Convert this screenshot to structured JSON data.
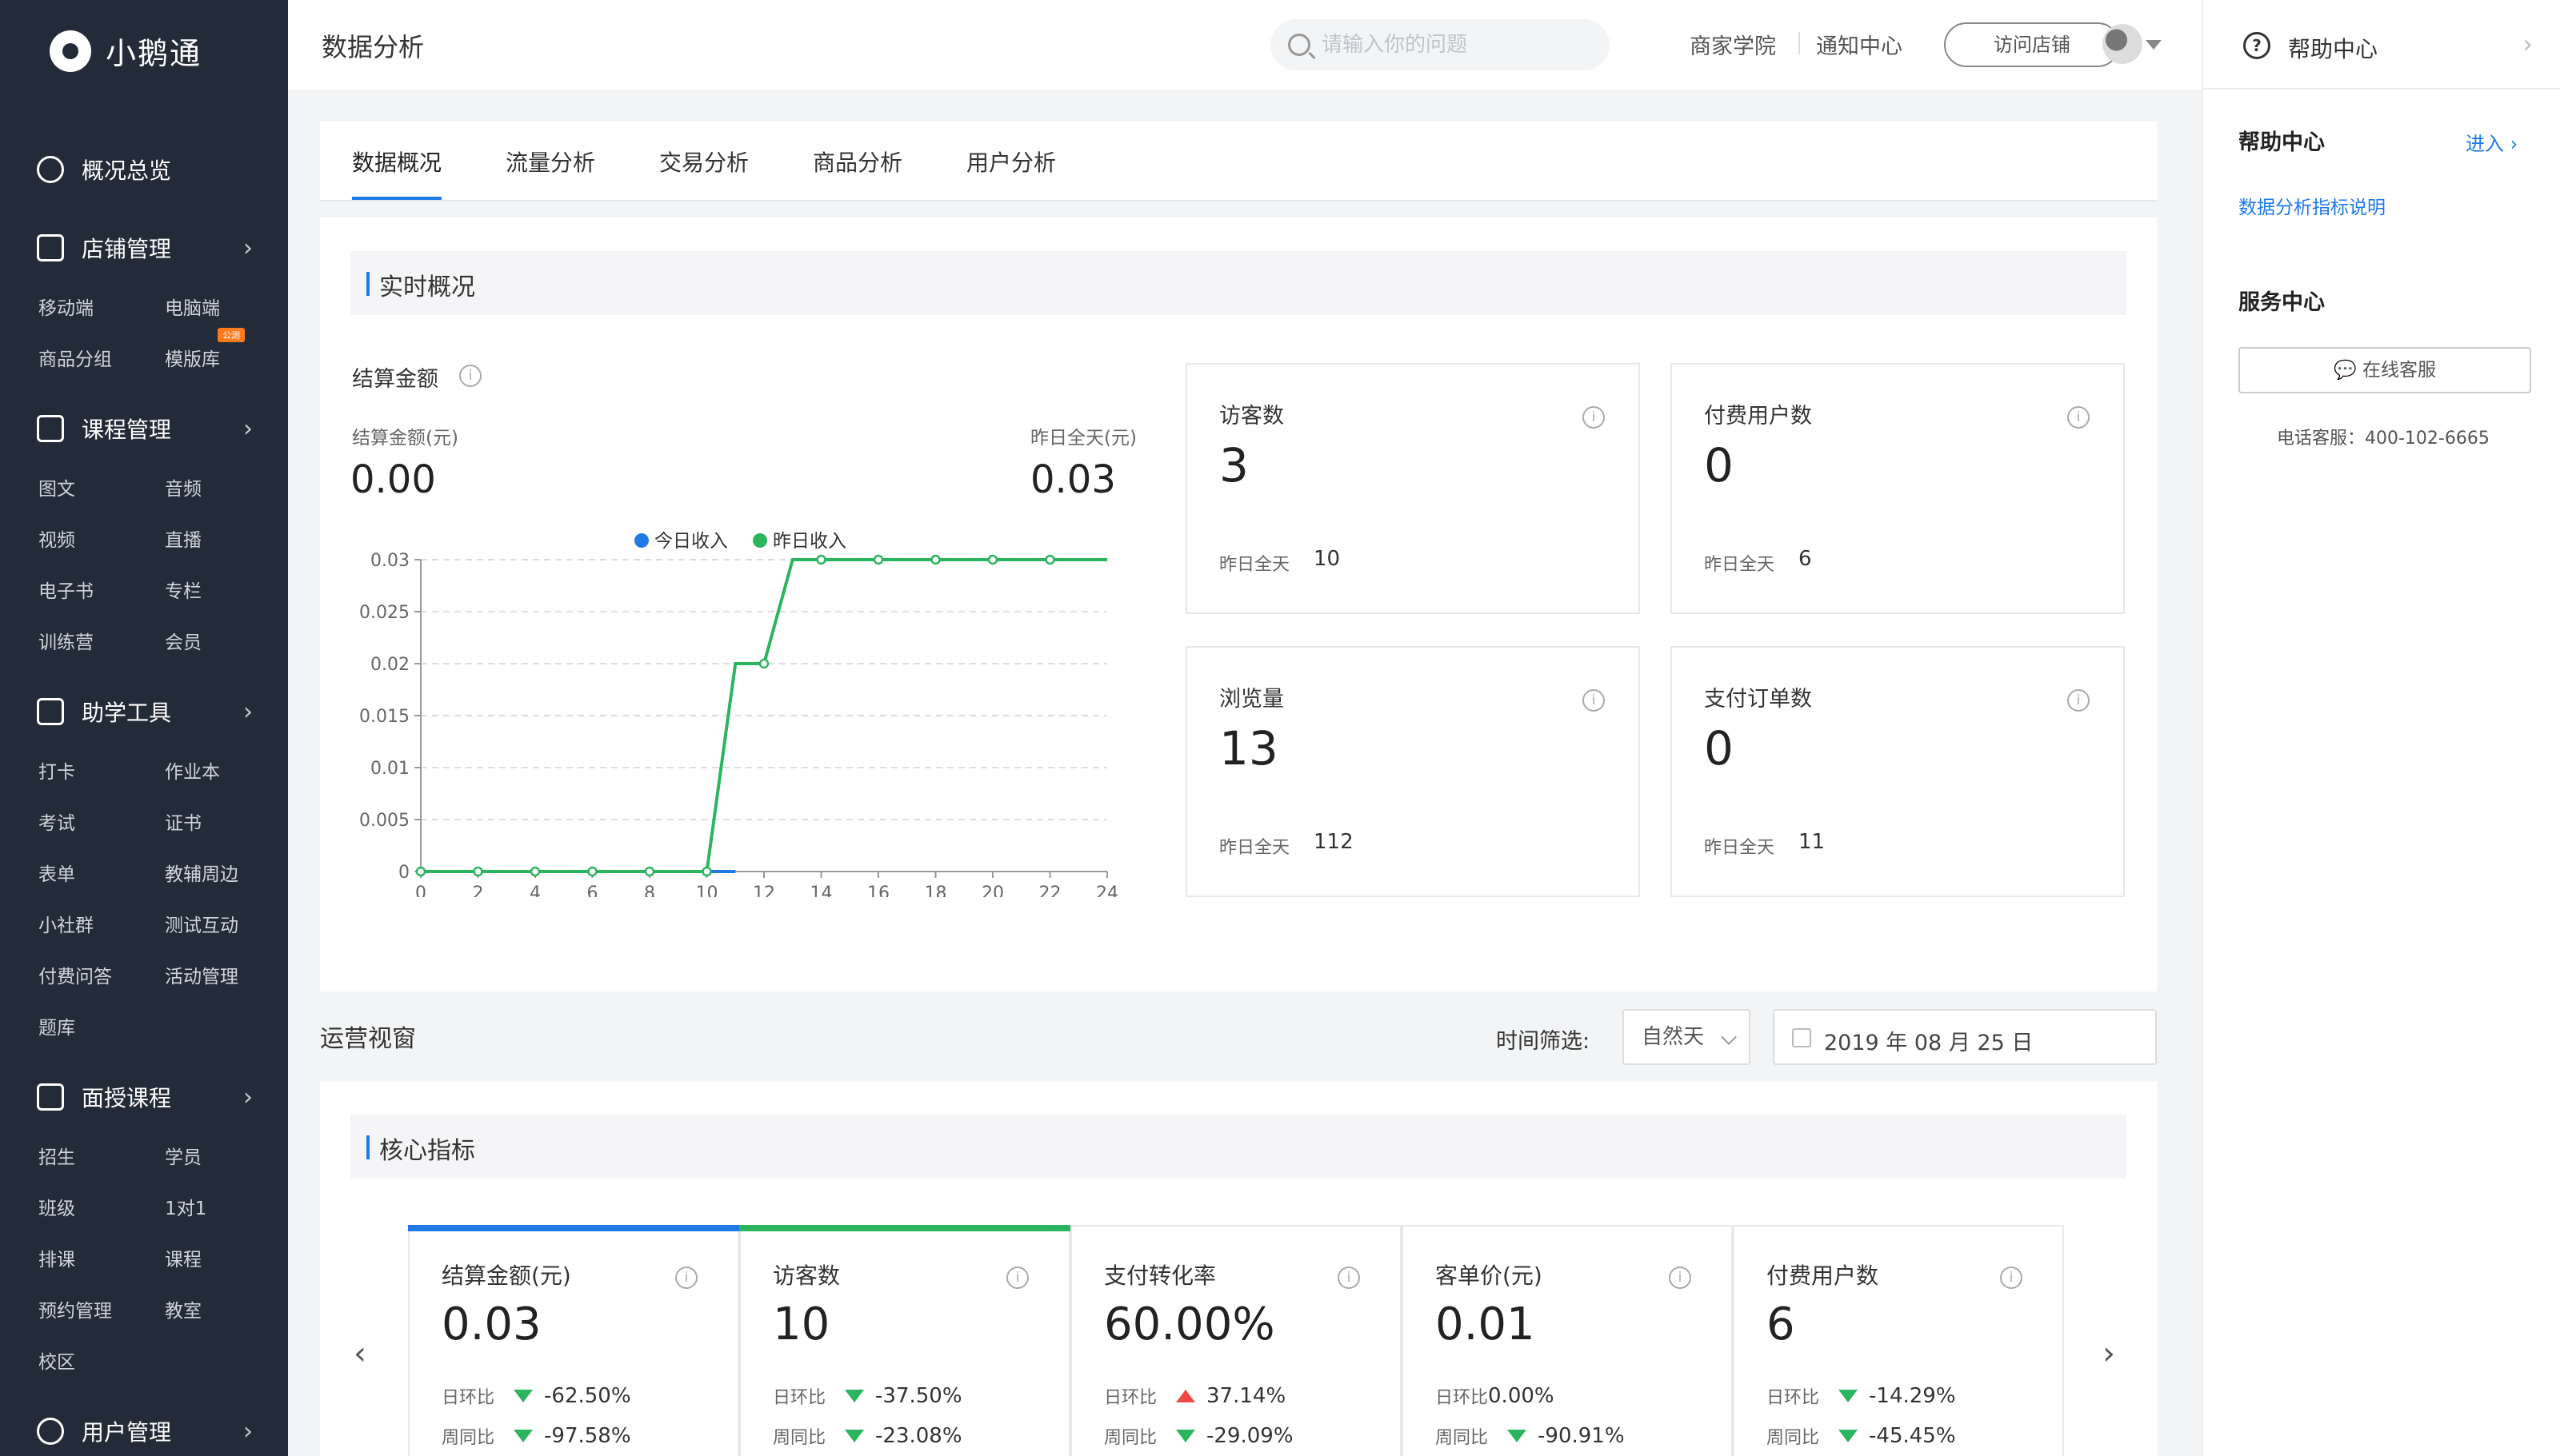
{
  "app": {
    "logo_text": "小鹅通",
    "page_title": "数据分析"
  },
  "sidebar": {
    "groups": [
      {
        "label": "概况总览",
        "icon": "pie-chart-icon",
        "items": []
      },
      {
        "label": "店铺管理",
        "icon": "store-icon",
        "items": [
          "移动端",
          "电脑端",
          "商品分组",
          "模版库"
        ]
      },
      {
        "label": "课程管理",
        "icon": "document-icon",
        "items": [
          "图文",
          "音频",
          "视频",
          "直播",
          "电子书",
          "专栏",
          "训练营",
          "会员"
        ]
      },
      {
        "label": "助学工具",
        "icon": "toolbox-icon",
        "items": [
          "打卡",
          "作业本",
          "考试",
          "证书",
          "表单",
          "教辅周边",
          "小社群",
          "测试互动",
          "付费问答",
          "活动管理",
          "题库"
        ]
      },
      {
        "label": "面授课程",
        "icon": "teacher-icon",
        "items": [
          "招生",
          "学员",
          "班级",
          "1对1",
          "排课",
          "课程",
          "预约管理",
          "教室",
          "校区"
        ]
      },
      {
        "label": "用户管理",
        "icon": "user-icon",
        "items": []
      }
    ],
    "badge": "公测"
  },
  "topbar": {
    "search_placeholder": "请输入你的问题",
    "links": [
      "商家学院",
      "通知中心"
    ],
    "visit_button": "访问店铺"
  },
  "right_panel": {
    "header": "帮助中心",
    "help_title": "帮助中心",
    "enter_link": "进入",
    "doc_link": "数据分析指标说明",
    "service_title": "服务中心",
    "service_button": "在线客服",
    "phone": "电话客服：400-102-6665"
  },
  "tabs": [
    {
      "label": "数据概况",
      "active": true
    },
    {
      "label": "流量分析",
      "active": false
    },
    {
      "label": "交易分析",
      "active": false
    },
    {
      "label": "商品分析",
      "active": false
    },
    {
      "label": "用户分析",
      "active": false
    }
  ],
  "realtime": {
    "section_title": "实时概况",
    "settlement_title": "结算金额",
    "today_label": "结算金额(元)",
    "today_value": "0.00",
    "yesterday_label": "昨日全天(元)",
    "yesterday_value": "0.03",
    "metrics": [
      {
        "label": "访客数",
        "value": "3",
        "yesterday_label": "昨日全天",
        "yesterday_value": "10"
      },
      {
        "label": "付费用户数",
        "value": "0",
        "yesterday_label": "昨日全天",
        "yesterday_value": "6"
      },
      {
        "label": "浏览量",
        "value": "13",
        "yesterday_label": "昨日全天",
        "yesterday_value": "112"
      },
      {
        "label": "支付订单数",
        "value": "0",
        "yesterday_label": "昨日全天",
        "yesterday_value": "11"
      }
    ]
  },
  "chart_data": {
    "type": "line",
    "xlim": [
      0,
      24
    ],
    "ylim": [
      0,
      0.03
    ],
    "xticks": [
      "0",
      "2",
      "4",
      "6",
      "8",
      "10",
      "12",
      "14",
      "16",
      "18",
      "20",
      "22",
      "24"
    ],
    "yticks": [
      "0",
      "0.005",
      "0.01",
      "0.015",
      "0.02",
      "0.025",
      "0.03"
    ],
    "grid": true,
    "legend_position": "top-center",
    "series": [
      {
        "name": "今日收入",
        "color": "#1f7ae8",
        "x": [
          0,
          1,
          2,
          3,
          4,
          5,
          6,
          7,
          8,
          9,
          10,
          11
        ],
        "y": [
          0,
          0,
          0,
          0,
          0,
          0,
          0,
          0,
          0,
          0,
          0,
          0
        ]
      },
      {
        "name": "昨日收入",
        "color": "#2bb55f",
        "x": [
          0,
          2,
          4,
          6,
          8,
          10,
          11,
          12,
          13,
          14,
          16,
          18,
          20,
          22,
          24
        ],
        "y": [
          0,
          0,
          0,
          0,
          0,
          0,
          0.02,
          0.02,
          0.03,
          0.03,
          0.03,
          0.03,
          0.03,
          0.03,
          0.03
        ],
        "markers_x": [
          0,
          2,
          4,
          6,
          8,
          10,
          12,
          14,
          16,
          18,
          20,
          22
        ]
      }
    ]
  },
  "ops": {
    "title": "运营视窗",
    "time_filter_label": "时间筛选:",
    "period": "自然天",
    "date": "2019 年 08 月 25 日",
    "section_title": "核心指标",
    "cards": [
      {
        "label": "结算金额(元)",
        "value": "0.03",
        "accent": "#1f7ae8",
        "day_label": "日环比",
        "day_dir": "down",
        "day_value": "-62.50%",
        "week_label": "周同比",
        "week_dir": "down",
        "week_value": "-97.58%"
      },
      {
        "label": "访客数",
        "value": "10",
        "accent": "#2bb55f",
        "day_label": "日环比",
        "day_dir": "down",
        "day_value": "-37.50%",
        "week_label": "周同比",
        "week_dir": "down",
        "week_value": "-23.08%"
      },
      {
        "label": "支付转化率",
        "value": "60.00%",
        "accent": "",
        "day_label": "日环比",
        "day_dir": "up",
        "day_value": "37.14%",
        "week_label": "周同比",
        "week_dir": "down",
        "week_value": "-29.09%"
      },
      {
        "label": "客单价(元)",
        "value": "0.01",
        "accent": "",
        "day_label": "日环比",
        "day_dir": "none",
        "day_value": "0.00%",
        "week_label": "周同比",
        "week_dir": "down",
        "week_value": "-90.91%"
      },
      {
        "label": "付费用户数",
        "value": "6",
        "accent": "",
        "day_label": "日环比",
        "day_dir": "down",
        "day_value": "-14.29%",
        "week_label": "周同比",
        "week_dir": "down",
        "week_value": "-45.45%"
      }
    ]
  }
}
